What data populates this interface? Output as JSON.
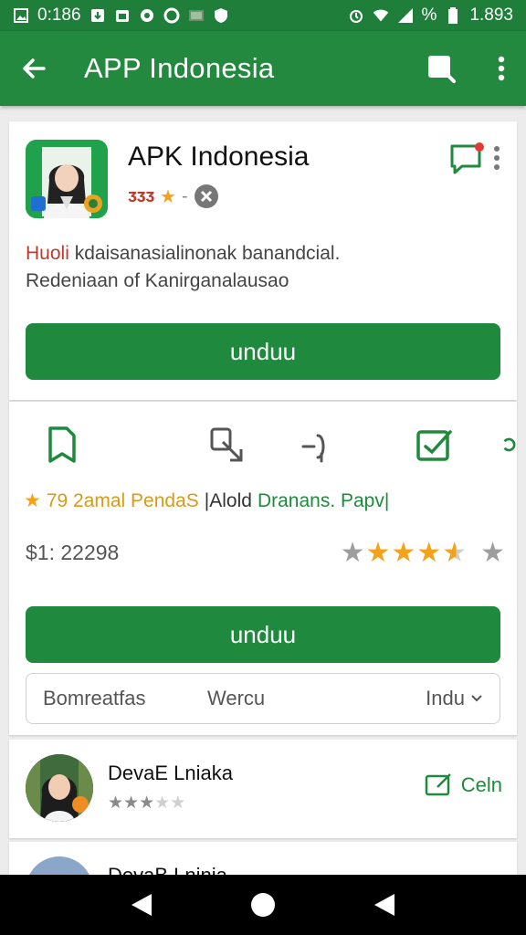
{
  "status_bar": {
    "time": "0:186",
    "battery_pct": "%",
    "right_value": "1.893",
    "icons": [
      "image-icon",
      "download-icon",
      "calendar-icon",
      "settings-icon",
      "circle-icon",
      "photo-icon",
      "shield-icon",
      "alarm-icon",
      "wifi-icon",
      "signal-icon",
      "battery-icon"
    ]
  },
  "app_bar": {
    "title": "APP Indonesia",
    "icons": [
      "back-arrow-icon",
      "search-icon",
      "more-vert-icon"
    ]
  },
  "app_card": {
    "name": "APK Indonesia",
    "rating_text": "ᴣᴣᴣ",
    "rating_separator": "-",
    "description_line1_prefix": "Huoli",
    "description_line1_rest": " kdaisanasialinonak banandcial.",
    "description_line2": "Redeniaan of  Kanirganalausao",
    "download_label": "unduu"
  },
  "detail_card": {
    "stat1": "79 2amal PendaS",
    "stat2": "|Alold",
    "stat3": "Dranans. Papv|",
    "price": "$1: 22298",
    "star_rating": 4.5,
    "download_label": "unduu",
    "chips": [
      "Bomreatfas",
      "Wercu",
      "Indu"
    ]
  },
  "review": {
    "name": "DevaE Lniaka",
    "stars": 3,
    "action_label": "Celn"
  },
  "review_next": {
    "name": "DevaB Lninia"
  },
  "colors": {
    "primary": "#23893f",
    "status_bar": "#1e7e3a",
    "accent_red": "#c0392b",
    "star": "#f4a21a"
  }
}
